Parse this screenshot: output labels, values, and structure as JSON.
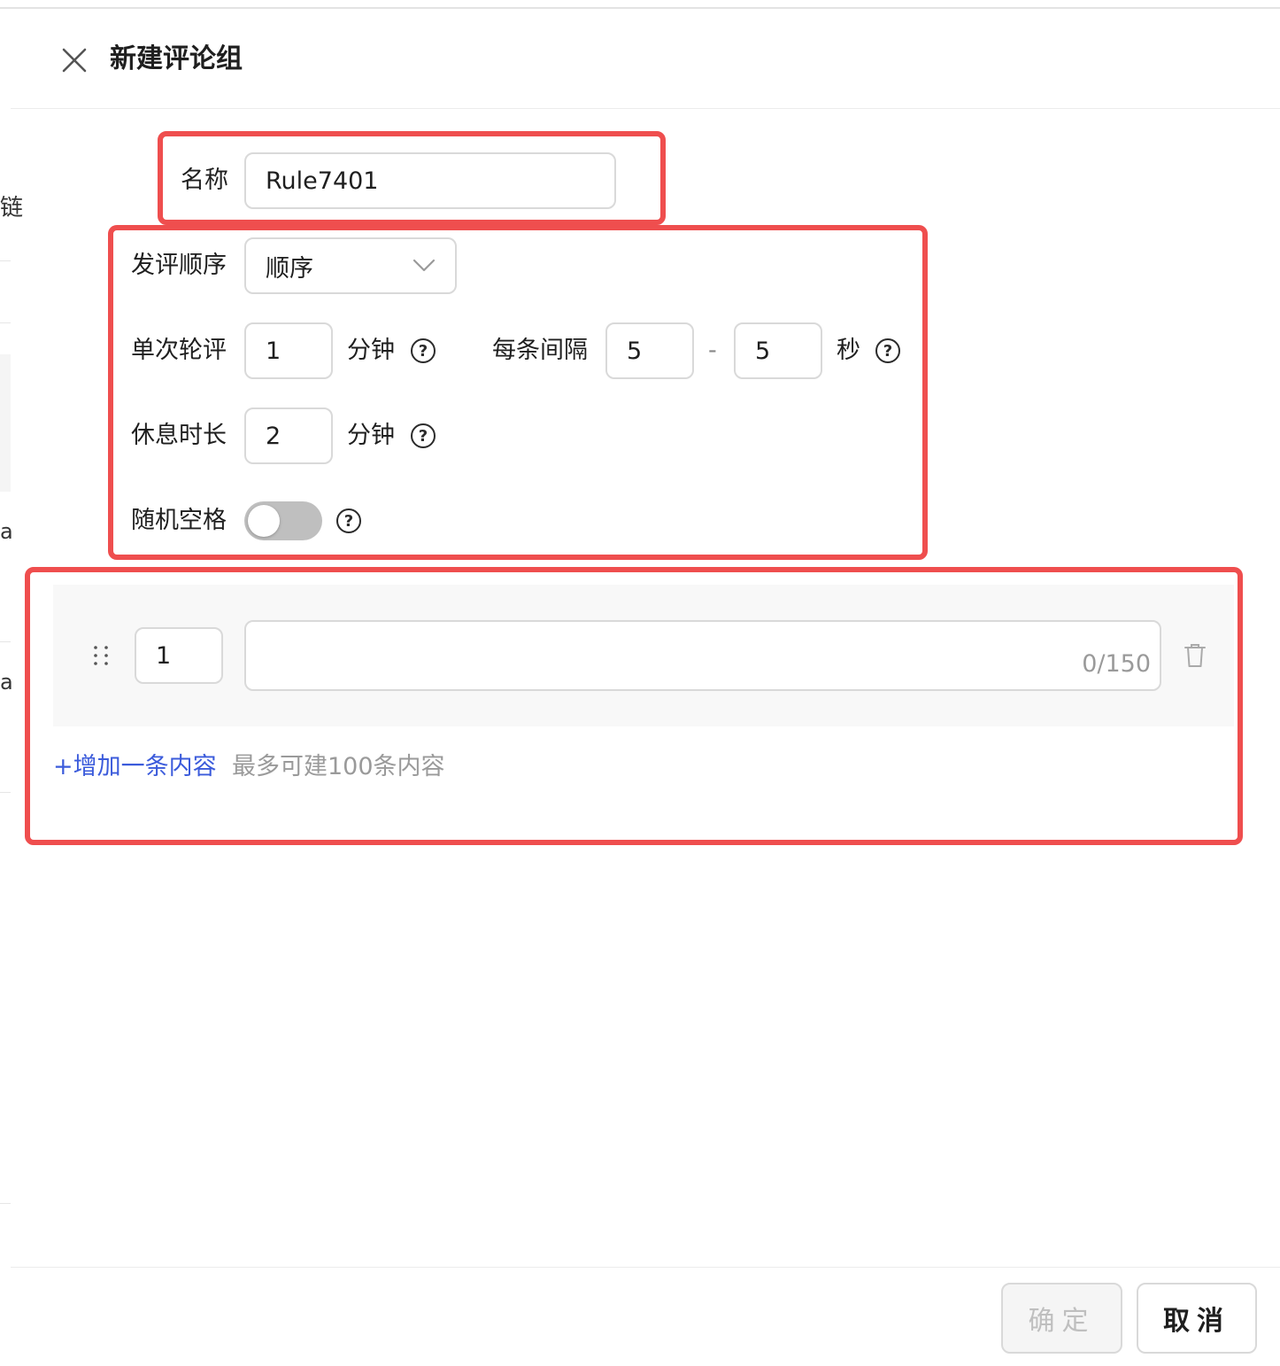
{
  "background": {
    "char_top": "链",
    "char_a1": "a",
    "char_a2": "a"
  },
  "drawer": {
    "title": "新建评论组",
    "close_icon": "close-icon"
  },
  "form": {
    "name": {
      "label": "名称",
      "value": "Rule7401"
    },
    "order": {
      "label": "发评顺序",
      "value": "顺序",
      "icon": "chevron-down-icon"
    },
    "single_round": {
      "label": "单次轮评",
      "value": "1",
      "unit": "分钟"
    },
    "interval": {
      "label": "每条间隔",
      "min": "5",
      "separator": "-",
      "max": "5",
      "unit": "秒"
    },
    "rest": {
      "label": "休息时长",
      "value": "2",
      "unit": "分钟"
    },
    "random_space": {
      "label": "随机空格",
      "enabled": false
    },
    "help_glyph": "?"
  },
  "content": {
    "items": [
      {
        "index": "1",
        "text": "",
        "counter": "0/150"
      }
    ],
    "add_label": "+增加一条内容",
    "hint": "最多可建100条内容"
  },
  "footer": {
    "confirm_label": "确定",
    "cancel_label": "取消"
  },
  "colors": {
    "highlight": "#ef4e4e",
    "link": "#3b5bdb",
    "toggle_off": "#bfbfbf"
  }
}
